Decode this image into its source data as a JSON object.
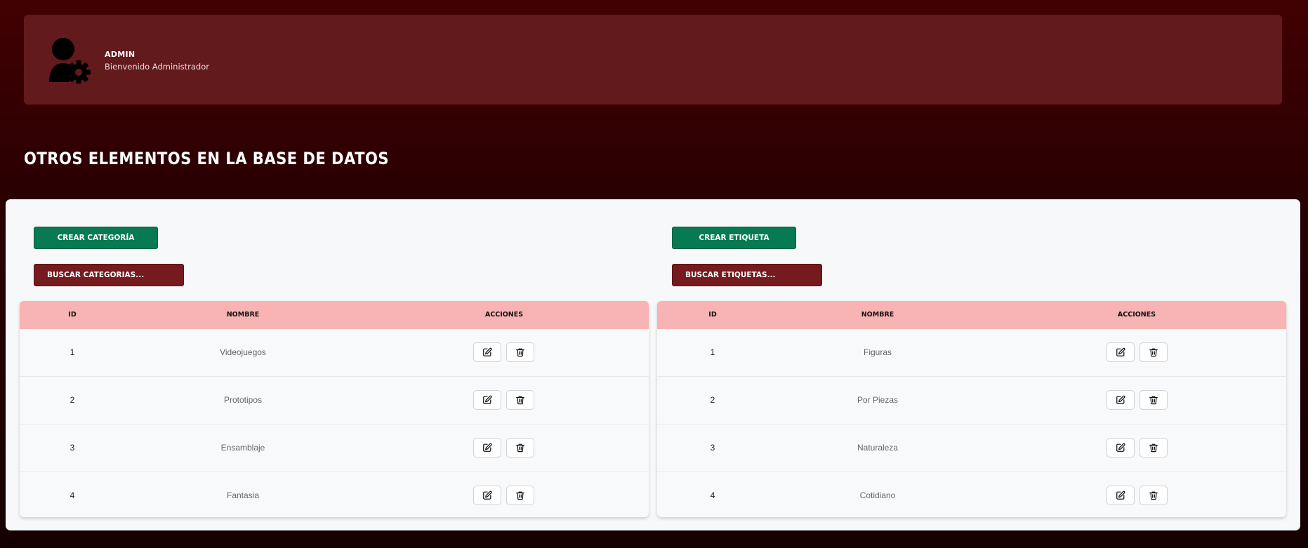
{
  "profile": {
    "role": "ADMIN",
    "greeting": "Bienvenido Administrador"
  },
  "section_title": "OTROS ELEMENTOS EN LA BASE DE DATOS",
  "categories": {
    "create_label": "CREAR CATEGORÍA",
    "search_placeholder": "BUSCAR CATEGORIAS...",
    "columns": [
      "ID",
      "NOMBRE",
      "ACCIONES"
    ],
    "rows": [
      {
        "id": "1",
        "name": "Videojuegos"
      },
      {
        "id": "2",
        "name": "Prototipos"
      },
      {
        "id": "3",
        "name": "Ensamblaje"
      },
      {
        "id": "4",
        "name": "Fantasia"
      }
    ]
  },
  "tags": {
    "create_label": "CREAR ETIQUETA",
    "search_placeholder": "BUSCAR ETIQUETAS...",
    "columns": [
      "ID",
      "NOMBRE",
      "ACCIONES"
    ],
    "rows": [
      {
        "id": "1",
        "name": "Figuras"
      },
      {
        "id": "2",
        "name": "Por Piezas"
      },
      {
        "id": "3",
        "name": "Naturaleza"
      },
      {
        "id": "4",
        "name": "Cotidiano"
      }
    ]
  },
  "icons": {
    "avatar": "user-gear-icon",
    "edit": "pencil-square-icon",
    "delete": "trash-icon"
  },
  "colors": {
    "background_top": "#420002",
    "profile_card": "#631a1d",
    "create_button": "#077a54",
    "search_field": "#751a1e",
    "table_header": "#f8b3b4"
  }
}
